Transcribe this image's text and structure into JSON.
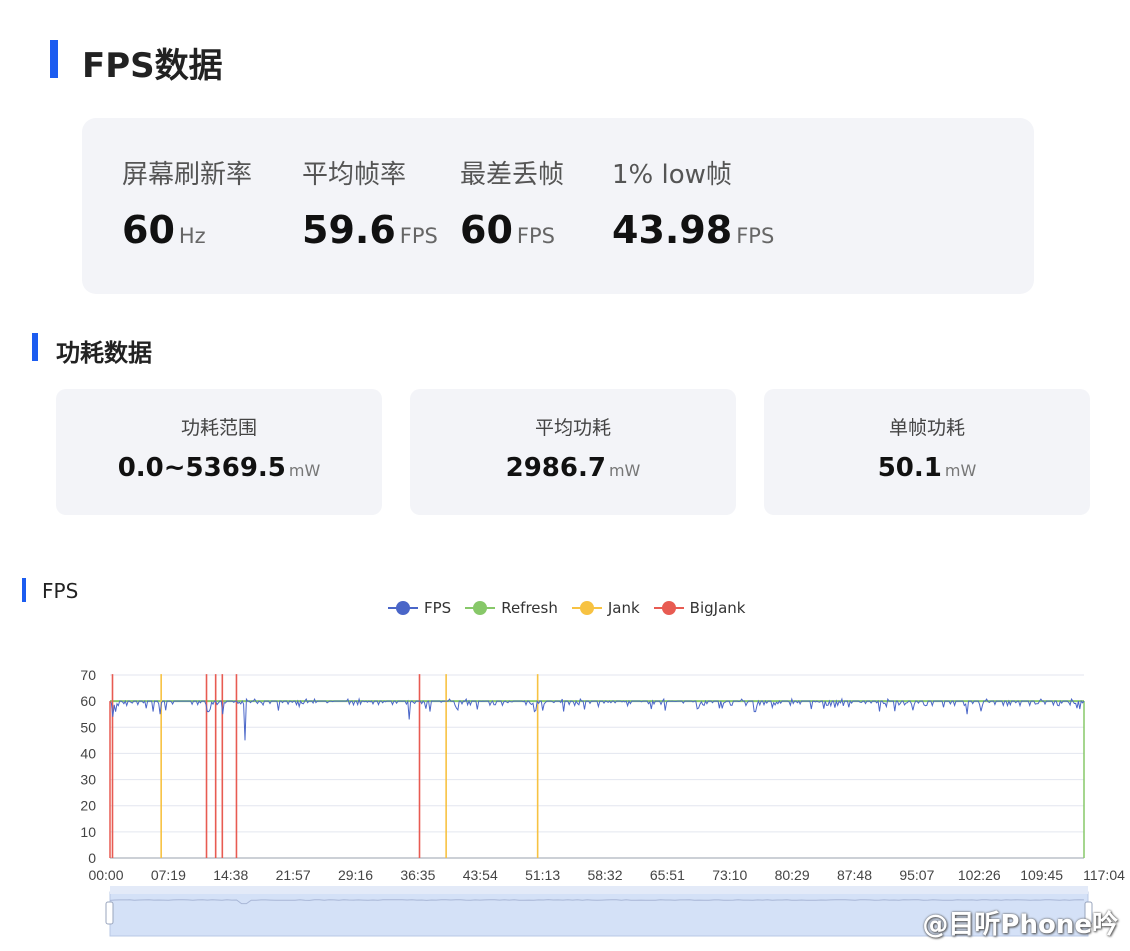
{
  "header": {
    "title": "FPS数据"
  },
  "fps_stats": [
    {
      "label": "屏幕刷新率",
      "value": "60",
      "unit": "Hz"
    },
    {
      "label": "平均帧率",
      "value": "59.6",
      "unit": "FPS"
    },
    {
      "label": "最差丢帧",
      "value": "60",
      "unit": "FPS"
    },
    {
      "label": "1% low帧",
      "value": "43.98",
      "unit": "FPS"
    }
  ],
  "power": {
    "title": "功耗数据",
    "cards": [
      {
        "label": "功耗范围",
        "value": "0.0~5369.5",
        "unit": "mW"
      },
      {
        "label": "平均功耗",
        "value": "2986.7",
        "unit": "mW"
      },
      {
        "label": "单帧功耗",
        "value": "50.1",
        "unit": "mW"
      }
    ]
  },
  "chart_section": {
    "title": "FPS"
  },
  "colors": {
    "accent": "#1c5cf0",
    "fps": "#4a66c8",
    "refresh": "#87c869",
    "jank": "#f7c242",
    "bigjank": "#e85b52"
  },
  "watermark": "@目听Phone吟",
  "chart_data": {
    "type": "line",
    "title": "",
    "xlabel": "",
    "ylabel": "",
    "ylim": [
      0,
      70
    ],
    "yticks": [
      0,
      10,
      20,
      30,
      40,
      50,
      60,
      70
    ],
    "xlim_minutes": [
      0,
      117.0667
    ],
    "xticks": [
      "00:00",
      "07:19",
      "14:38",
      "21:57",
      "29:16",
      "36:35",
      "43:54",
      "51:13",
      "58:32",
      "65:51",
      "73:10",
      "80:29",
      "87:48",
      "95:07",
      "102:26",
      "109:45",
      "117:04"
    ],
    "grid": true,
    "legend_position": "top-center",
    "series": [
      {
        "name": "FPS",
        "baseline": 59.6,
        "dips": [
          {
            "t": 0.3,
            "v": 54
          },
          {
            "t": 0.7,
            "v": 56
          },
          {
            "t": 5.2,
            "v": 56
          },
          {
            "t": 6.0,
            "v": 55
          },
          {
            "t": 11.8,
            "v": 56
          },
          {
            "t": 13.5,
            "v": 55
          },
          {
            "t": 16.2,
            "v": 45
          },
          {
            "t": 36.0,
            "v": 53
          },
          {
            "t": 38.5,
            "v": 56
          },
          {
            "t": 51.0,
            "v": 56
          },
          {
            "t": 65.0,
            "v": 57
          },
          {
            "t": 77.5,
            "v": 56
          },
          {
            "t": 103.0,
            "v": 55
          },
          {
            "t": 116.5,
            "v": 57
          }
        ]
      },
      {
        "name": "Refresh",
        "value": 60
      },
      {
        "name": "Jank",
        "events": [
          6.15,
          40.4,
          51.4
        ]
      },
      {
        "name": "BigJank",
        "events": [
          0.3,
          11.6,
          12.7,
          13.5,
          15.2,
          37.2
        ]
      }
    ]
  }
}
